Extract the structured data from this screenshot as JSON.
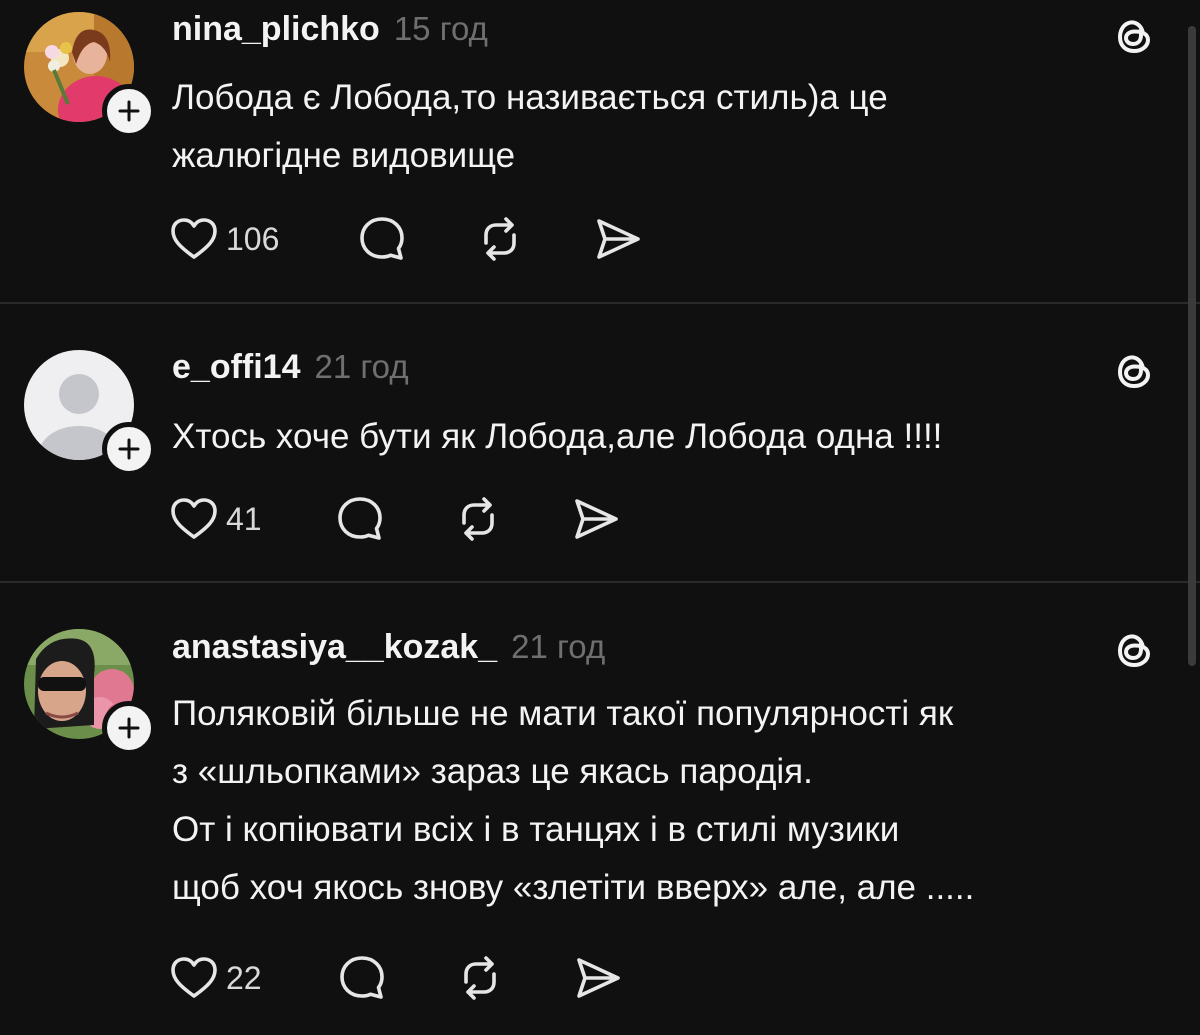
{
  "posts": [
    {
      "username": "nina_plichko",
      "time": "15 год",
      "lines": [
        "Лобода є Лобода,то називається стиль)а це",
        "жалюгідне видовище"
      ],
      "likes": "106",
      "avatar": "photo-woman-flowers"
    },
    {
      "username": "e_offi14",
      "time": "21 год",
      "lines": [
        "Хтось хоче бути як Лобода,але Лобода одна !!!!"
      ],
      "likes": "41",
      "avatar": "default-avatar"
    },
    {
      "username": "anastasiya__kozak_",
      "time": "21 год",
      "lines": [
        "Поляковій більше не мати такої популярності як",
        "з «шльопками» зараз це якась пародія.",
        "От і копіювати всіх і в танцях і в стилі музики",
        "щоб хоч якось знову «злетіти вверх» але, але ....."
      ],
      "likes": "22",
      "avatar": "photo-woman-sunglasses-roses"
    }
  ],
  "icons": {
    "like": "heart-icon",
    "reply": "comment-icon",
    "repost": "repost-icon",
    "share": "send-icon",
    "threads": "threads-logo-icon",
    "follow": "plus-icon"
  },
  "colors": {
    "background": "#101010",
    "text": "#f3f3f3",
    "muted": "#6f6f6f",
    "divider": "#2a2a2a"
  }
}
